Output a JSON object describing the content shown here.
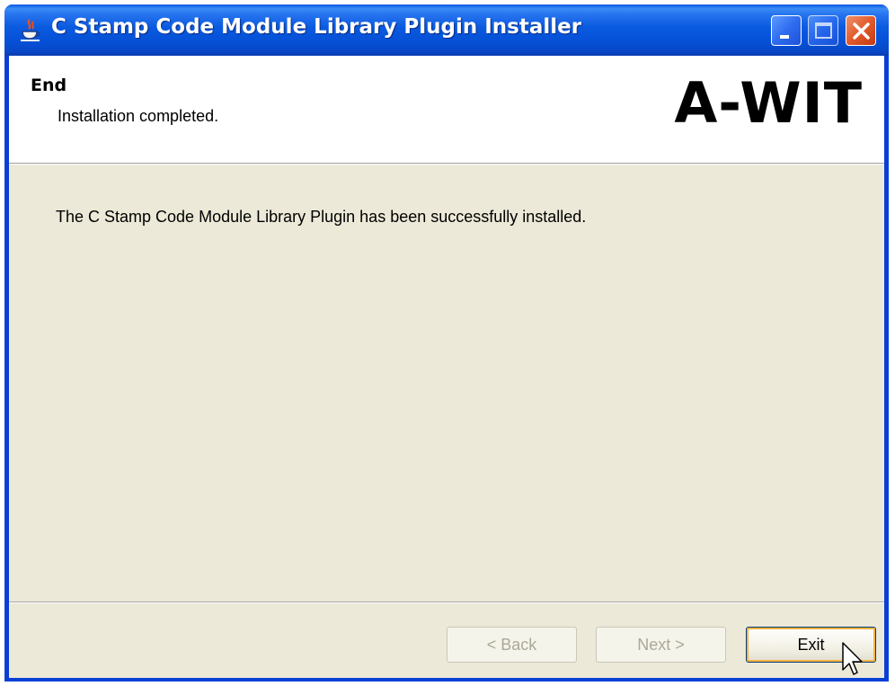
{
  "window": {
    "title": "C Stamp Code Module Library Plugin Installer",
    "icon": "java-cup-icon"
  },
  "titlebar_buttons": {
    "minimize": "minimize-icon",
    "maximize": "maximize-icon",
    "close": "close-icon"
  },
  "header": {
    "title": "End",
    "subtitle": "Installation completed.",
    "logo": "A-WIT"
  },
  "content": {
    "message": "The C Stamp Code Module Library Plugin has been successfully installed."
  },
  "buttons": {
    "back": "< Back",
    "next": "Next >",
    "exit": "Exit"
  },
  "colors": {
    "titlebar": "#0a5ae0",
    "client_background": "#ece9d8",
    "header_background": "#ffffff",
    "close_button": "#e25a2c",
    "focus_ring": "#f8b440"
  }
}
